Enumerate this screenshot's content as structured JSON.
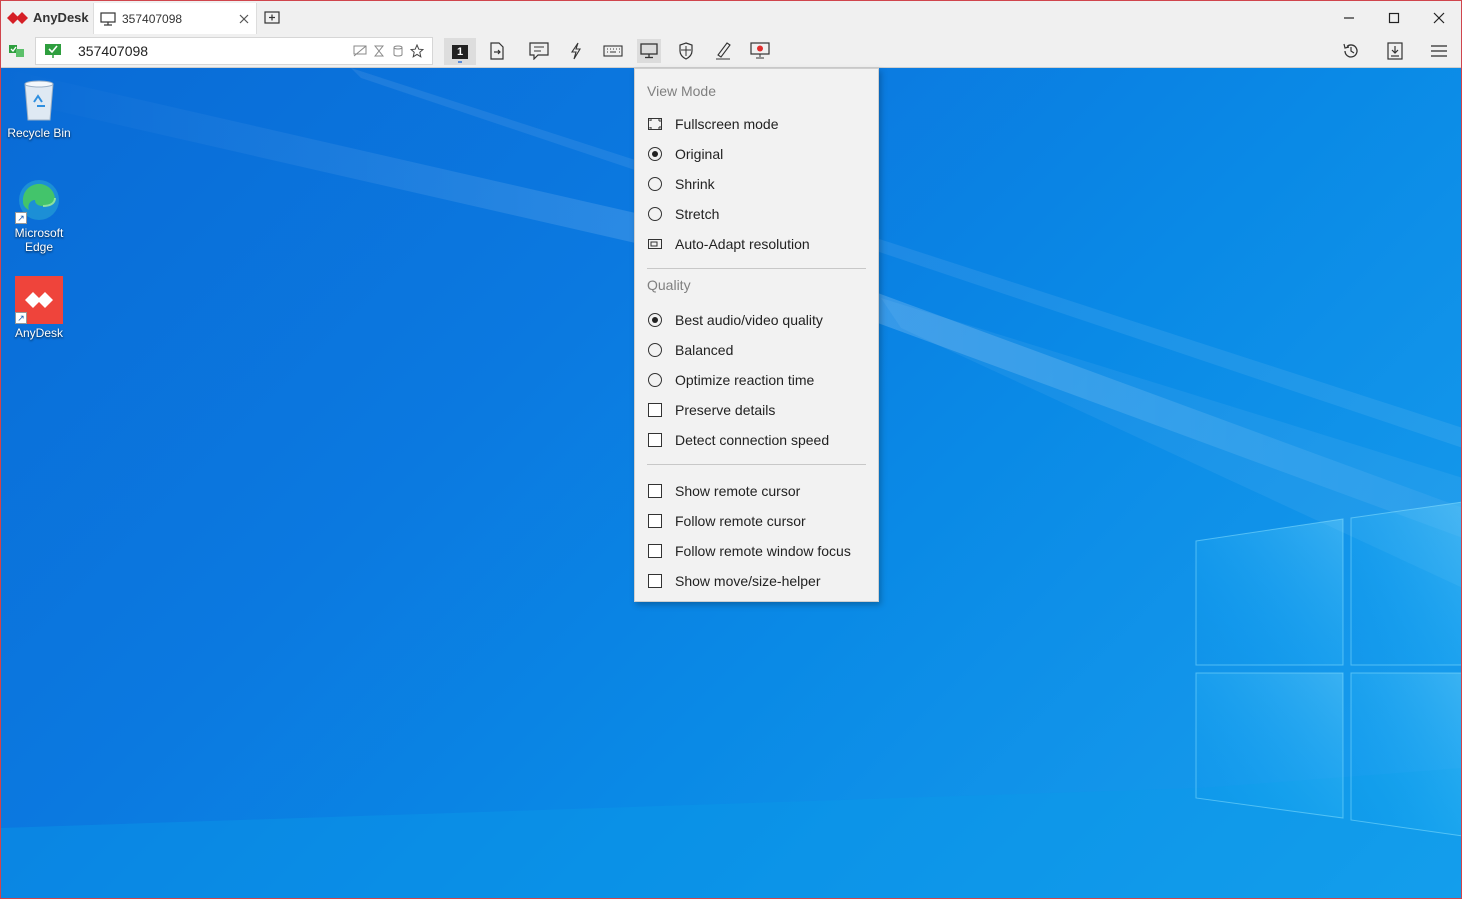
{
  "app": {
    "name": "AnyDesk",
    "tab_title": "357407098",
    "address_value": "357407098",
    "monitor_number": "1"
  },
  "window_controls": [
    "minimize-icon",
    "maximize-icon",
    "close-icon"
  ],
  "toolbar": {
    "icons": [
      "file-transfer-icon",
      "chat-icon",
      "actions-lightning-icon",
      "keyboard-icon",
      "display-icon",
      "permissions-shield-icon",
      "whiteboard-pen-icon",
      "record-icon"
    ],
    "right_icons": [
      "history-icon",
      "download-icon",
      "menu-icon"
    ]
  },
  "desktop": {
    "icons": [
      {
        "label": "Recycle Bin"
      },
      {
        "label": "Microsoft Edge"
      },
      {
        "label": "AnyDesk"
      }
    ]
  },
  "menu": {
    "view_mode_header": "View Mode",
    "fullscreen": "Fullscreen mode",
    "original": "Original",
    "shrink": "Shrink",
    "stretch": "Stretch",
    "auto_adapt": "Auto-Adapt resolution",
    "quality_header": "Quality",
    "best_quality": "Best audio/video quality",
    "balanced": "Balanced",
    "optimize_reaction": "Optimize reaction time",
    "preserve_details": "Preserve details",
    "detect_speed": "Detect connection speed",
    "show_remote_cursor": "Show remote cursor",
    "follow_remote_cursor": "Follow remote cursor",
    "follow_window_focus": "Follow remote window focus",
    "show_move_helper": "Show move/size-helper",
    "selected_view_mode": "Original",
    "selected_quality": "Best audio/video quality"
  },
  "colors": {
    "accent": "#d0454c",
    "desktop_blue": "#0a7ade"
  }
}
